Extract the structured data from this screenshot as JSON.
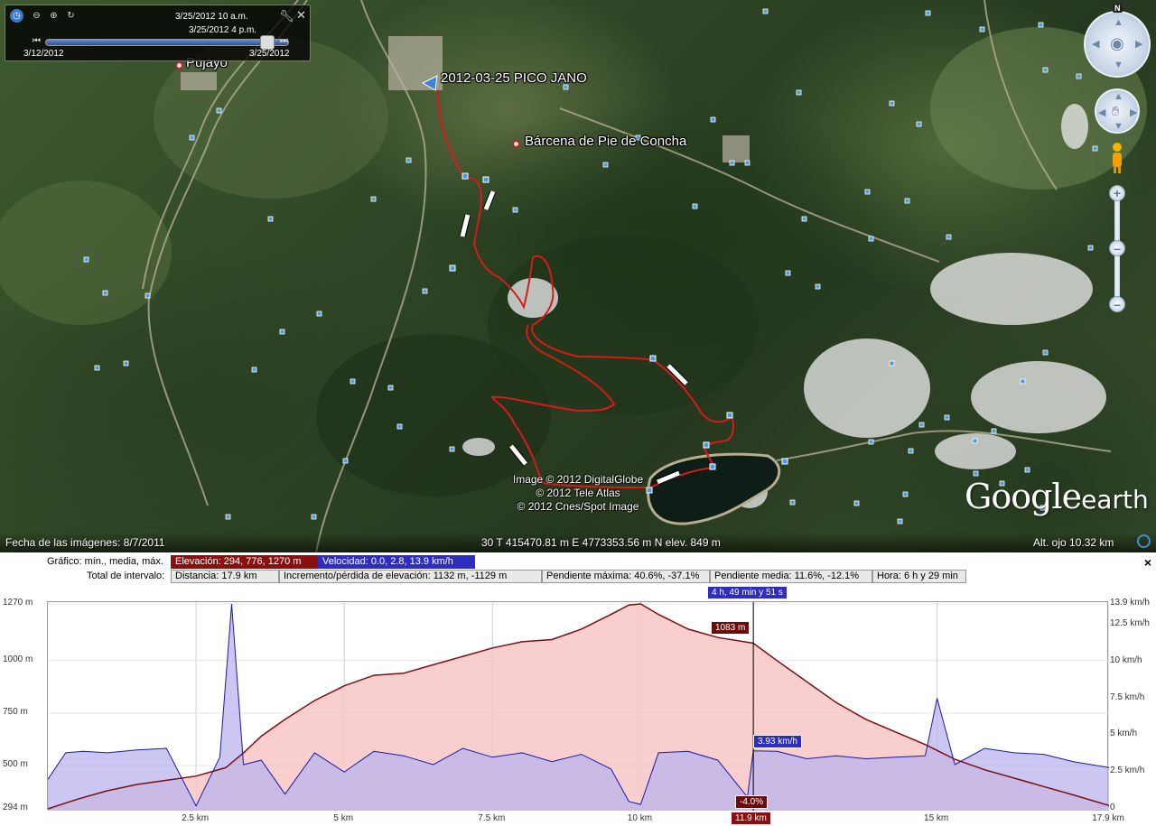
{
  "time_slider": {
    "time_top": "3/25/2012  10 a.m.",
    "time_bottom": "3/25/2012    4 p.m.",
    "start_date": "3/12/2012",
    "end_date": "3/25/2012"
  },
  "map": {
    "track_title": "2012-03-25 PICO JANO",
    "places": [
      {
        "name": "Pujayo"
      },
      {
        "name": "Bárcena de Pie de Concha"
      }
    ],
    "credits": [
      "Image © 2012 DigitalGlobe",
      "© 2012 Tele Atlas",
      "© 2012 Cnes/Spot Image"
    ],
    "logo_google": "Google",
    "logo_earth": "earth",
    "compass_letter": "N"
  },
  "status": {
    "imagery_date": "Fecha de las imágenes: 8/7/2011",
    "coords": "30 T 415470.81 m E 4773353.56 m N elev.   849 m",
    "eye_alt": "Alt. ojo    10.32 km"
  },
  "profile": {
    "graph_label": "Gráfico: mín., media, máx.",
    "elevation_stat": "Elevación: 294, 776, 1270 m",
    "speed_stat": "Velocidad: 0.0, 2.8, 13.9 km/h",
    "interval_label": "Total de intervalo:",
    "distance_stat": "Distancia: 17.9 km",
    "gain_stat": "Incremento/pérdida de elevación: 1132 m, -1129 m",
    "max_slope_stat": "Pendiente máxima: 40.6%, -37.1%",
    "avg_slope_stat": "Pendiente media: 11.6%, -12.1%",
    "time_stat": "Hora: 6 h y 29 min",
    "cursor_time": "4 h, 49 min y 51 s",
    "cursor_elev": "1083 m",
    "cursor_speed": "3.93 km/h",
    "cursor_slope": "-4.0%",
    "cursor_dist": "11.9 km",
    "close_label": "×"
  },
  "chart_data": {
    "type": "area",
    "x_unit": "km",
    "x_ticks": [
      "2.5 km",
      "5 km",
      "7.5 km",
      "10 km",
      "11.9 km",
      "15 km",
      "17.9 km"
    ],
    "y_left_ticks": [
      "1270 m",
      "1000 m",
      "750 m",
      "500 m",
      "294 m"
    ],
    "y_right_ticks": [
      "13.9 km/h",
      "12.5 km/h",
      "10 km/h",
      "7.5 km/h",
      "5 km/h",
      "2.5 km/h",
      "0"
    ],
    "xlim": [
      0,
      17.9
    ],
    "ylim_left": [
      294,
      1270
    ],
    "ylim_right": [
      0,
      13.9
    ],
    "series": [
      {
        "name": "Elevación",
        "color": "#7a0f12",
        "fill": "#f7c6c6",
        "x": [
          0,
          0.5,
          1.0,
          1.5,
          2.0,
          2.5,
          3.0,
          3.3,
          3.6,
          4.0,
          4.5,
          5.0,
          5.5,
          6.0,
          6.5,
          7.0,
          7.5,
          8.0,
          8.5,
          9.0,
          9.5,
          9.8,
          10.0,
          10.3,
          10.8,
          11.3,
          11.9,
          12.3,
          12.8,
          13.3,
          13.8,
          14.3,
          14.8,
          15.3,
          15.8,
          16.3,
          16.8,
          17.3,
          17.9
        ],
        "y": [
          294,
          340,
          380,
          410,
          430,
          450,
          490,
          560,
          640,
          720,
          810,
          880,
          930,
          940,
          980,
          1020,
          1060,
          1090,
          1100,
          1150,
          1220,
          1265,
          1270,
          1220,
          1150,
          1110,
          1083,
          1000,
          900,
          800,
          720,
          660,
          600,
          530,
          480,
          440,
          400,
          360,
          310
        ]
      },
      {
        "name": "Velocidad",
        "color": "#1a1aa8",
        "fill": "#b9b3ee",
        "x": [
          0,
          0.3,
          0.6,
          1.0,
          1.5,
          2.0,
          2.5,
          2.9,
          3.1,
          3.3,
          3.6,
          4.0,
          4.5,
          5.0,
          5.5,
          6.0,
          6.5,
          7.0,
          7.5,
          8.0,
          8.5,
          9.0,
          9.5,
          9.8,
          10.0,
          10.3,
          10.8,
          11.3,
          11.8,
          11.9,
          12.3,
          12.8,
          13.3,
          13.8,
          14.3,
          14.8,
          15.0,
          15.3,
          15.8,
          16.3,
          16.8,
          17.3,
          17.9
        ],
        "y": [
          2.0,
          3.8,
          3.9,
          3.8,
          4.0,
          4.1,
          0.2,
          3.5,
          13.9,
          3.0,
          3.3,
          1.0,
          3.8,
          2.5,
          3.9,
          3.6,
          3.0,
          4.1,
          3.5,
          3.8,
          3.2,
          3.7,
          2.7,
          0.5,
          0.3,
          3.8,
          3.9,
          3.3,
          0.8,
          3.93,
          3.9,
          3.4,
          3.6,
          3.4,
          3.5,
          3.6,
          7.5,
          3.0,
          4.1,
          3.8,
          3.7,
          3.2,
          2.8
        ]
      }
    ],
    "cursor": {
      "x": 11.9
    }
  }
}
